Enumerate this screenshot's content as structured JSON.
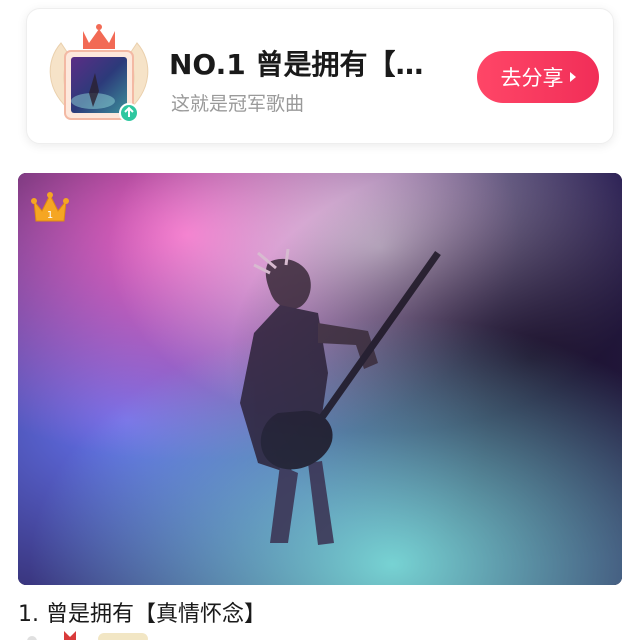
{
  "banner": {
    "title": "NO.1 曾是拥有【…",
    "subtitle": "这就是冠军歌曲",
    "share_label": "去分享"
  },
  "cover": {
    "rank_badge": "1"
  },
  "song": {
    "title": "1. 曾是拥有【真情怀念】"
  },
  "colors": {
    "accent": "#f12e58",
    "crown": "#f5a623"
  }
}
